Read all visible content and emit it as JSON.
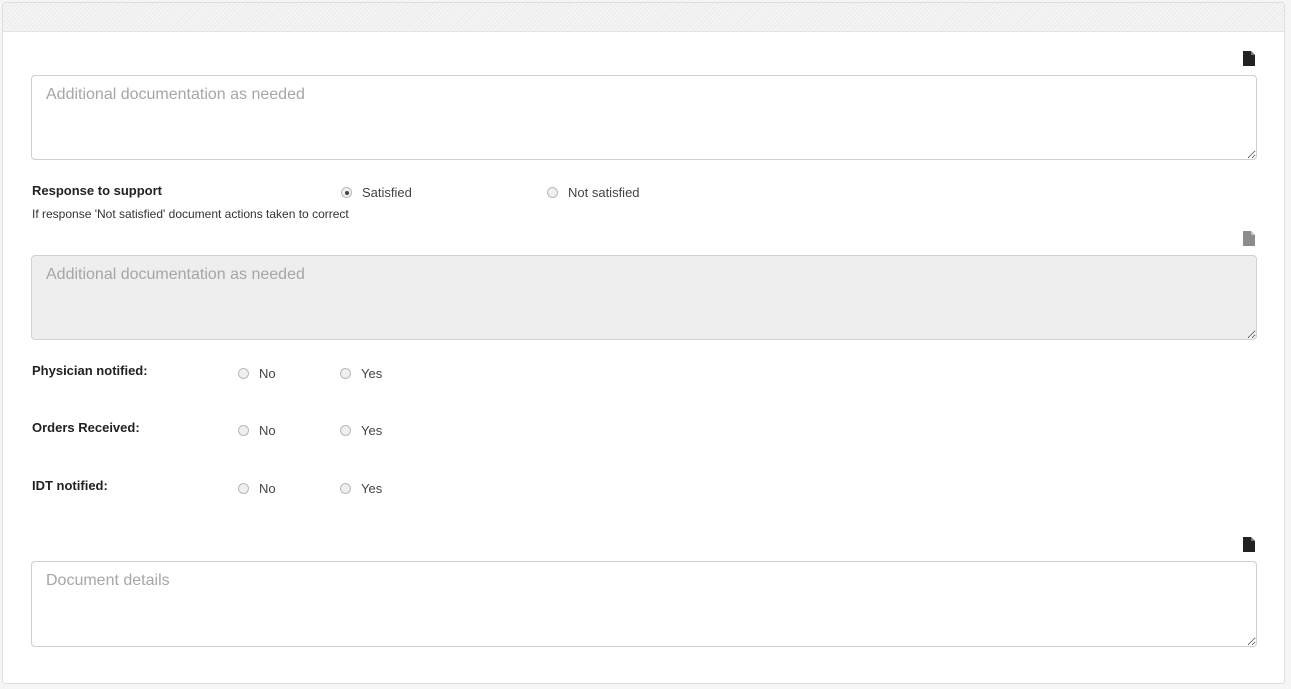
{
  "notes": {
    "additional_1_placeholder": "Additional documentation as needed",
    "additional_2_placeholder": "Additional documentation as needed",
    "details_placeholder": "Document details"
  },
  "response": {
    "label": "Response to support",
    "options": [
      "Satisfied",
      "Not satisfied"
    ],
    "selected": "Satisfied",
    "hint": "If response 'Not satisfied' document actions taken to correct"
  },
  "physician": {
    "label": "Physician notified:",
    "no": "No",
    "yes": "Yes"
  },
  "orders": {
    "label": "Orders Received:",
    "no": "No",
    "yes": "Yes"
  },
  "idt": {
    "label": "IDT notified:",
    "no": "No",
    "yes": "Yes"
  },
  "icons": {
    "doc_icon": "file-icon",
    "doc_icon_color": "#222222",
    "doc_icon_disabled_color": "#8c8c8c"
  }
}
